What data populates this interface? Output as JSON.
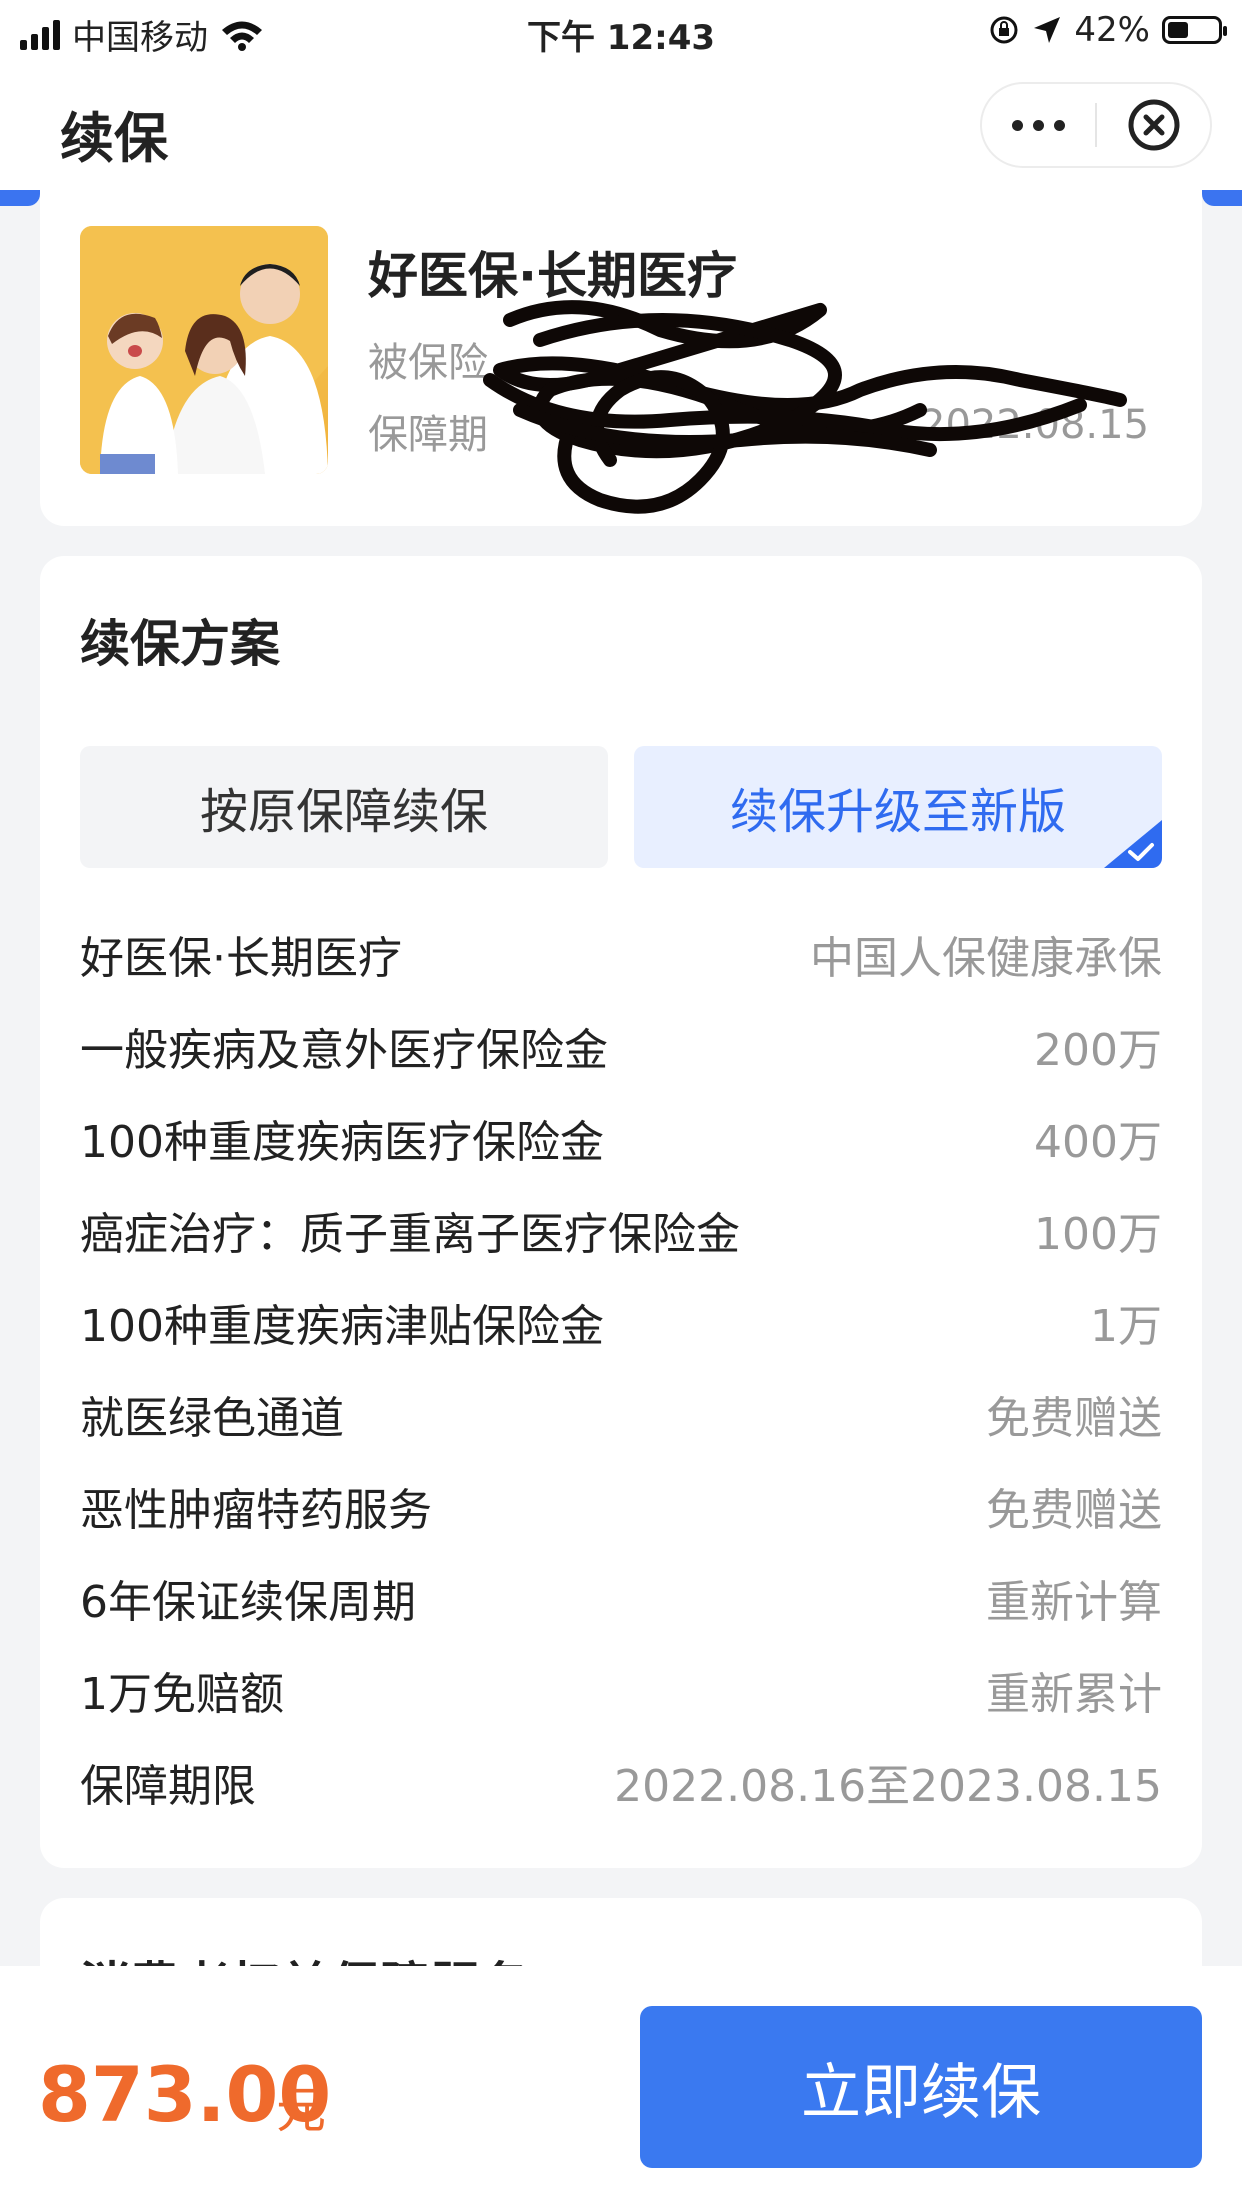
{
  "status_bar": {
    "carrier": "中国移动",
    "time": "下午 12:43",
    "battery_percent": "42%",
    "battery_level": 0.42
  },
  "nav": {
    "title": "续保",
    "more_icon": "more-dots-icon",
    "close_icon": "close-circle-icon"
  },
  "product": {
    "name": "好医保·长期医疗",
    "insured_label": "被保险",
    "period_label": "保障期",
    "period_tail": "2022.08.15"
  },
  "plan": {
    "title": "续保方案",
    "options": [
      {
        "label": "按原保障续保",
        "selected": false
      },
      {
        "label": "续保升级至新版",
        "selected": true
      }
    ],
    "rows": [
      {
        "k": "好医保·长期医疗",
        "v": "中国人保健康承保"
      },
      {
        "k": "一般疾病及意外医疗保险金",
        "v": "200万"
      },
      {
        "k": "100种重度疾病医疗保险金",
        "v": "400万"
      },
      {
        "k": "癌症治疗：质子重离子医疗保险金",
        "v": "100万"
      },
      {
        "k": "100种重度疾病津贴保险金",
        "v": "1万"
      },
      {
        "k": "就医绿色通道",
        "v": "免费赠送"
      },
      {
        "k": "恶性肿瘤特药服务",
        "v": "免费赠送"
      },
      {
        "k": "6年保证续保周期",
        "v": "重新计算"
      },
      {
        "k": "1万免赔额",
        "v": "重新累计"
      },
      {
        "k": "保障期限",
        "v": "2022.08.16至2023.08.15"
      }
    ]
  },
  "next_section": {
    "title": "消费者权益保障服务"
  },
  "footer": {
    "price": "873.00",
    "unit": "元",
    "button": "立即续保"
  },
  "colors": {
    "accent": "#3a79f0",
    "price": "#ef6a2c",
    "selected_bg": "#e8efff"
  }
}
